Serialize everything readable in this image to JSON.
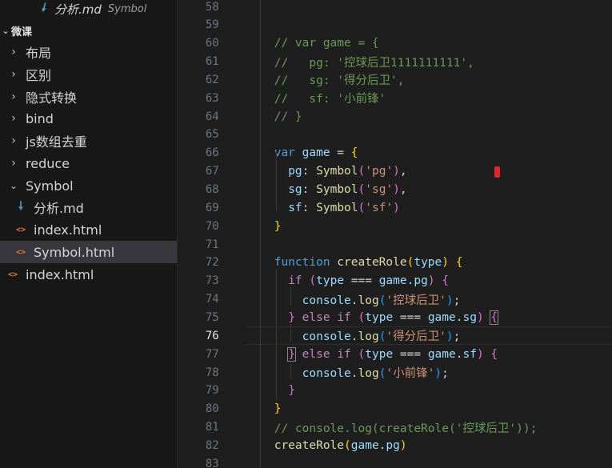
{
  "open_editor": {
    "filename": "分析.md",
    "description": "Symbol"
  },
  "explorer": {
    "root_label": "微课",
    "items": [
      {
        "label": "布局",
        "type": "folder",
        "expanded": false
      },
      {
        "label": "区别",
        "type": "folder",
        "expanded": false
      },
      {
        "label": "隐式转换",
        "type": "folder",
        "expanded": false
      },
      {
        "label": "bind",
        "type": "folder",
        "expanded": false
      },
      {
        "label": "js数组去重",
        "type": "folder",
        "expanded": false
      },
      {
        "label": "reduce",
        "type": "folder",
        "expanded": false
      },
      {
        "label": "Symbol",
        "type": "folder",
        "expanded": true
      },
      {
        "label": "分析.md",
        "type": "md",
        "indent": 1
      },
      {
        "label": "index.html",
        "type": "html",
        "indent": 1
      },
      {
        "label": "Symbol.html",
        "type": "html",
        "indent": 1,
        "selected": true
      },
      {
        "label": "index.html",
        "type": "html",
        "indent": 0
      }
    ]
  },
  "editor": {
    "active_line": "76",
    "lines": [
      {
        "n": "58",
        "tokens": []
      },
      {
        "n": "59",
        "tokens": []
      },
      {
        "n": "60",
        "tokens": [
          {
            "t": "// var game = {",
            "c": "c"
          }
        ]
      },
      {
        "n": "61",
        "tokens": [
          {
            "t": "//   pg: '控球后卫1111111111',",
            "c": "c"
          }
        ]
      },
      {
        "n": "62",
        "tokens": [
          {
            "t": "//   sg: '得分后卫',",
            "c": "c"
          }
        ]
      },
      {
        "n": "63",
        "tokens": [
          {
            "t": "//   sf: '小前锋'",
            "c": "c"
          }
        ]
      },
      {
        "n": "64",
        "tokens": [
          {
            "t": "// }",
            "c": "c"
          }
        ]
      },
      {
        "n": "65",
        "tokens": []
      },
      {
        "n": "66",
        "tokens": [
          {
            "t": "var",
            "c": "kw"
          },
          {
            "t": " ",
            "c": "pl"
          },
          {
            "t": "game",
            "c": "var"
          },
          {
            "t": " = ",
            "c": "pl"
          },
          {
            "t": "{",
            "c": "br1"
          }
        ]
      },
      {
        "n": "67",
        "tokens": [
          {
            "t": "  ",
            "c": "pl"
          },
          {
            "t": "pg",
            "c": "var"
          },
          {
            "t": ": ",
            "c": "pl"
          },
          {
            "t": "Symbol",
            "c": "fn"
          },
          {
            "t": "(",
            "c": "br2"
          },
          {
            "t": "'pg'",
            "c": "str"
          },
          {
            "t": ")",
            "c": "br2"
          },
          {
            "t": ",",
            "c": "pl"
          }
        ]
      },
      {
        "n": "68",
        "tokens": [
          {
            "t": "  ",
            "c": "pl"
          },
          {
            "t": "sg",
            "c": "var"
          },
          {
            "t": ": ",
            "c": "pl"
          },
          {
            "t": "Symbol",
            "c": "fn"
          },
          {
            "t": "(",
            "c": "br2"
          },
          {
            "t": "'sg'",
            "c": "str"
          },
          {
            "t": ")",
            "c": "br2"
          },
          {
            "t": ",",
            "c": "pl"
          }
        ]
      },
      {
        "n": "69",
        "tokens": [
          {
            "t": "  ",
            "c": "pl"
          },
          {
            "t": "sf",
            "c": "var"
          },
          {
            "t": ": ",
            "c": "pl"
          },
          {
            "t": "Symbol",
            "c": "fn"
          },
          {
            "t": "(",
            "c": "br2"
          },
          {
            "t": "'sf'",
            "c": "str"
          },
          {
            "t": ")",
            "c": "br2"
          }
        ]
      },
      {
        "n": "70",
        "tokens": [
          {
            "t": "}",
            "c": "br1"
          }
        ]
      },
      {
        "n": "71",
        "tokens": []
      },
      {
        "n": "72",
        "tokens": [
          {
            "t": "function",
            "c": "kw"
          },
          {
            "t": " ",
            "c": "pl"
          },
          {
            "t": "createRole",
            "c": "fn"
          },
          {
            "t": "(",
            "c": "br1"
          },
          {
            "t": "type",
            "c": "var"
          },
          {
            "t": ")",
            "c": "br1"
          },
          {
            "t": " ",
            "c": "pl"
          },
          {
            "t": "{",
            "c": "br1"
          }
        ]
      },
      {
        "n": "73",
        "tokens": [
          {
            "t": "  ",
            "c": "pl"
          },
          {
            "t": "if",
            "c": "kw2"
          },
          {
            "t": " ",
            "c": "pl"
          },
          {
            "t": "(",
            "c": "br2"
          },
          {
            "t": "type",
            "c": "var"
          },
          {
            "t": " === ",
            "c": "pl"
          },
          {
            "t": "game",
            "c": "var"
          },
          {
            "t": ".",
            "c": "pl"
          },
          {
            "t": "pg",
            "c": "var"
          },
          {
            "t": ")",
            "c": "br2"
          },
          {
            "t": " ",
            "c": "pl"
          },
          {
            "t": "{",
            "c": "br2"
          }
        ]
      },
      {
        "n": "74",
        "tokens": [
          {
            "t": "    ",
            "c": "pl"
          },
          {
            "t": "console",
            "c": "var"
          },
          {
            "t": ".",
            "c": "pl"
          },
          {
            "t": "log",
            "c": "fn"
          },
          {
            "t": "(",
            "c": "br3"
          },
          {
            "t": "'控球后卫'",
            "c": "str"
          },
          {
            "t": ")",
            "c": "br3"
          },
          {
            "t": ";",
            "c": "pl"
          }
        ]
      },
      {
        "n": "75",
        "tokens": [
          {
            "t": "  ",
            "c": "pl"
          },
          {
            "t": "}",
            "c": "br2"
          },
          {
            "t": " ",
            "c": "pl"
          },
          {
            "t": "else",
            "c": "kw2"
          },
          {
            "t": " ",
            "c": "pl"
          },
          {
            "t": "if",
            "c": "kw2"
          },
          {
            "t": " ",
            "c": "pl"
          },
          {
            "t": "(",
            "c": "br2"
          },
          {
            "t": "type",
            "c": "var"
          },
          {
            "t": " === ",
            "c": "pl"
          },
          {
            "t": "game",
            "c": "var"
          },
          {
            "t": ".",
            "c": "pl"
          },
          {
            "t": "sg",
            "c": "var"
          },
          {
            "t": ")",
            "c": "br2"
          },
          {
            "t": " ",
            "c": "pl"
          },
          {
            "t": "{",
            "c": "br2",
            "m": true
          }
        ]
      },
      {
        "n": "76",
        "tokens": [
          {
            "t": "    ",
            "c": "pl"
          },
          {
            "t": "console",
            "c": "var"
          },
          {
            "t": ".",
            "c": "pl"
          },
          {
            "t": "log",
            "c": "fn"
          },
          {
            "t": "(",
            "c": "br3"
          },
          {
            "t": "'得分后卫'",
            "c": "str"
          },
          {
            "t": ")",
            "c": "br3"
          },
          {
            "t": ";",
            "c": "pl"
          }
        ]
      },
      {
        "n": "77",
        "tokens": [
          {
            "t": "  ",
            "c": "pl"
          },
          {
            "t": "}",
            "c": "br2",
            "m": true
          },
          {
            "t": " ",
            "c": "pl"
          },
          {
            "t": "else",
            "c": "kw2"
          },
          {
            "t": " ",
            "c": "pl"
          },
          {
            "t": "if",
            "c": "kw2"
          },
          {
            "t": " ",
            "c": "pl"
          },
          {
            "t": "(",
            "c": "br2"
          },
          {
            "t": "type",
            "c": "var"
          },
          {
            "t": " === ",
            "c": "pl"
          },
          {
            "t": "game",
            "c": "var"
          },
          {
            "t": ".",
            "c": "pl"
          },
          {
            "t": "sf",
            "c": "var"
          },
          {
            "t": ")",
            "c": "br2"
          },
          {
            "t": " ",
            "c": "pl"
          },
          {
            "t": "{",
            "c": "br2"
          }
        ]
      },
      {
        "n": "78",
        "tokens": [
          {
            "t": "    ",
            "c": "pl"
          },
          {
            "t": "console",
            "c": "var"
          },
          {
            "t": ".",
            "c": "pl"
          },
          {
            "t": "log",
            "c": "fn"
          },
          {
            "t": "(",
            "c": "br3"
          },
          {
            "t": "'小前锋'",
            "c": "str"
          },
          {
            "t": ")",
            "c": "br3"
          },
          {
            "t": ";",
            "c": "pl"
          }
        ]
      },
      {
        "n": "79",
        "tokens": [
          {
            "t": "  ",
            "c": "pl"
          },
          {
            "t": "}",
            "c": "br2"
          }
        ]
      },
      {
        "n": "80",
        "tokens": [
          {
            "t": "}",
            "c": "br1"
          }
        ]
      },
      {
        "n": "81",
        "tokens": [
          {
            "t": "// console.log(createRole('控球后卫'));",
            "c": "c"
          }
        ]
      },
      {
        "n": "82",
        "tokens": [
          {
            "t": "createRole",
            "c": "fn"
          },
          {
            "t": "(",
            "c": "br1"
          },
          {
            "t": "game",
            "c": "var"
          },
          {
            "t": ".",
            "c": "pl"
          },
          {
            "t": "pg",
            "c": "var"
          },
          {
            "t": ")",
            "c": "br1"
          }
        ]
      },
      {
        "n": "83",
        "tokens": []
      }
    ]
  },
  "colors": {
    "sidebar_bg": "#181818",
    "editor_bg": "#1e1e1e",
    "selected_row": "#37373d",
    "comment": "#6a9955",
    "keyword": "#569cd6",
    "control_keyword": "#c586c0",
    "function": "#dcdcaa",
    "string": "#ce9178",
    "variable": "#9cdcfe"
  }
}
